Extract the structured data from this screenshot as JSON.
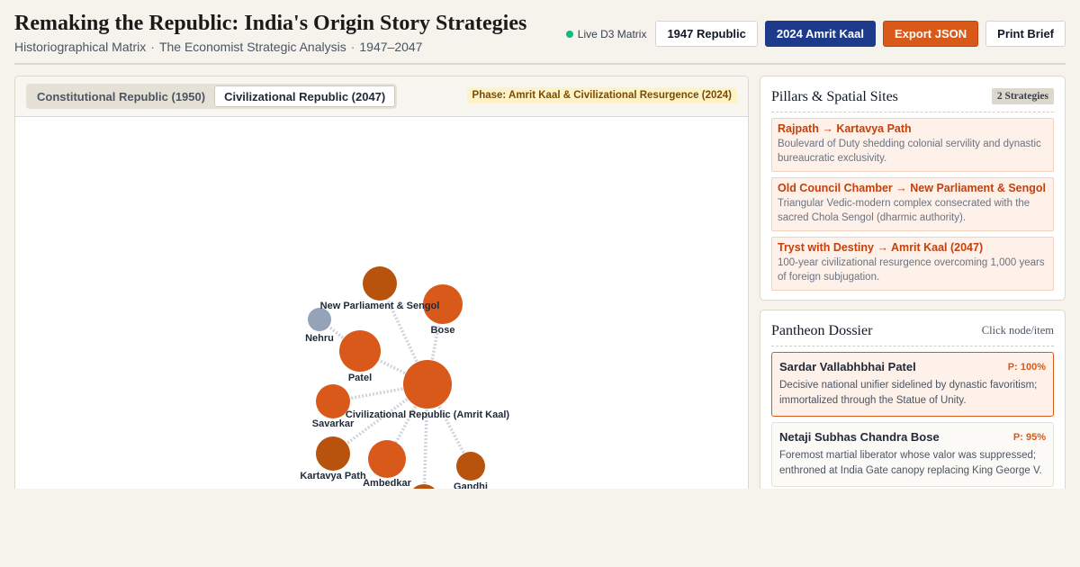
{
  "header": {
    "title": "Remaking the Republic: India's Origin Story Strategies",
    "subtitle_parts": [
      "Historiographical Matrix",
      "The Economist Strategic Analysis",
      "1947–2047"
    ],
    "live_label": "Live D3 Matrix",
    "buttons": {
      "republic_1947": "1947 Republic",
      "amrit_kaal_2024": "2024 Amrit Kaal",
      "export_json": "Export JSON",
      "print_brief": "Print Brief"
    }
  },
  "graph": {
    "tabs": [
      "Constitutional Republic (1950)",
      "Civilizational Republic (2047)"
    ],
    "active_tab": 1,
    "phase": "Phase: Amrit Kaal & Civilizational Resurgence (2024)",
    "nodes": [
      {
        "id": "center",
        "label": "Civilizational Republic (Amrit Kaal)",
        "color": "#d9591b"
      },
      {
        "id": "parliament",
        "label": "New Parliament & Sengol",
        "color": "#b8530e"
      },
      {
        "id": "bose",
        "label": "Bose",
        "color": "#d9591b"
      },
      {
        "id": "nehru",
        "label": "Nehru",
        "color": "#94a3b8"
      },
      {
        "id": "patel",
        "label": "Patel",
        "color": "#d9591b"
      },
      {
        "id": "savarkar",
        "label": "Savarkar",
        "color": "#d9591b"
      },
      {
        "id": "kartavya",
        "label": "Kartavya Path",
        "color": "#b8530e"
      },
      {
        "id": "ambedkar",
        "label": "Ambedkar",
        "color": "#d9591b"
      },
      {
        "id": "gandhi",
        "label": "Gandhi",
        "color": "#b8530e"
      },
      {
        "id": "bottom",
        "label": "",
        "color": "#b8530e"
      }
    ]
  },
  "pillars": {
    "title": "Pillars & Spatial Sites",
    "badge": "2 Strategies",
    "arrow": "→",
    "items": [
      {
        "from": "Rajpath",
        "to": "Kartavya Path",
        "desc": "Boulevard of Duty shedding colonial servility and dynastic bureaucratic exclusivity."
      },
      {
        "from": "Old Council Chamber",
        "to": "New Parliament & Sengol",
        "desc": "Triangular Vedic-modern complex consecrated with the sacred Chola Sengol (dharmic authority)."
      },
      {
        "from": "Tryst with Destiny",
        "to": "Amrit Kaal (2047)",
        "desc": "100-year civilizational resurgence overcoming 1,000 years of foreign subjugation."
      }
    ]
  },
  "pantheon": {
    "title": "Pantheon Dossier",
    "hint": "Click node/item",
    "items": [
      {
        "name": "Sardar Vallabhbhai Patel",
        "p": "P: 100%",
        "desc": "Decisive national unifier sidelined by dynastic favoritism; immortalized through the Statue of Unity."
      },
      {
        "name": "Netaji Subhas Chandra Bose",
        "p": "P: 95%",
        "desc": "Foremost martial liberator whose valor was suppressed; enthroned at India Gate canopy replacing King George V."
      }
    ]
  }
}
